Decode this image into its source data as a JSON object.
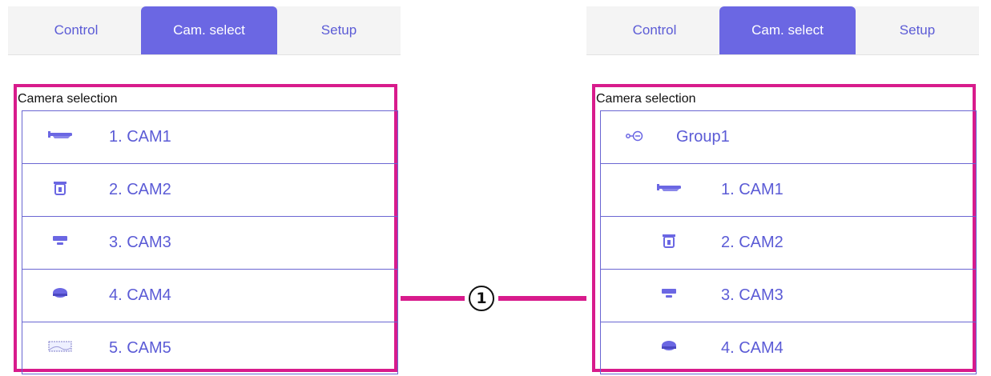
{
  "colors": {
    "accent": "#6b67e3",
    "link": "#5b5bd6",
    "highlight": "#d81b8c"
  },
  "left_panel": {
    "tabs": [
      {
        "label": "Control"
      },
      {
        "label": "Cam. select"
      },
      {
        "label": "Setup"
      }
    ],
    "active_tab": "Cam. select",
    "section_label": "Camera selection",
    "cameras": [
      {
        "label": "1. CAM1",
        "icon": "box-camera-icon"
      },
      {
        "label": "2. CAM2",
        "icon": "ptz-camera-icon"
      },
      {
        "label": "3. CAM3",
        "icon": "dome-camera-icon"
      },
      {
        "label": "4. CAM4",
        "icon": "fixed-dome-camera-icon"
      },
      {
        "label": "5. CAM5",
        "icon": "panoramic-camera-icon"
      }
    ]
  },
  "right_panel": {
    "tabs": [
      {
        "label": "Control"
      },
      {
        "label": "Cam. select"
      },
      {
        "label": "Setup"
      }
    ],
    "active_tab": "Cam. select",
    "section_label": "Camera selection",
    "group": {
      "label": "Group1",
      "icon": "group-collapse-icon"
    },
    "cameras": [
      {
        "label": "1. CAM1",
        "icon": "box-camera-icon"
      },
      {
        "label": "2. CAM2",
        "icon": "ptz-camera-icon"
      },
      {
        "label": "3. CAM3",
        "icon": "dome-camera-icon"
      },
      {
        "label": "4. CAM4",
        "icon": "fixed-dome-camera-icon"
      }
    ]
  },
  "callout": {
    "label": "1"
  }
}
